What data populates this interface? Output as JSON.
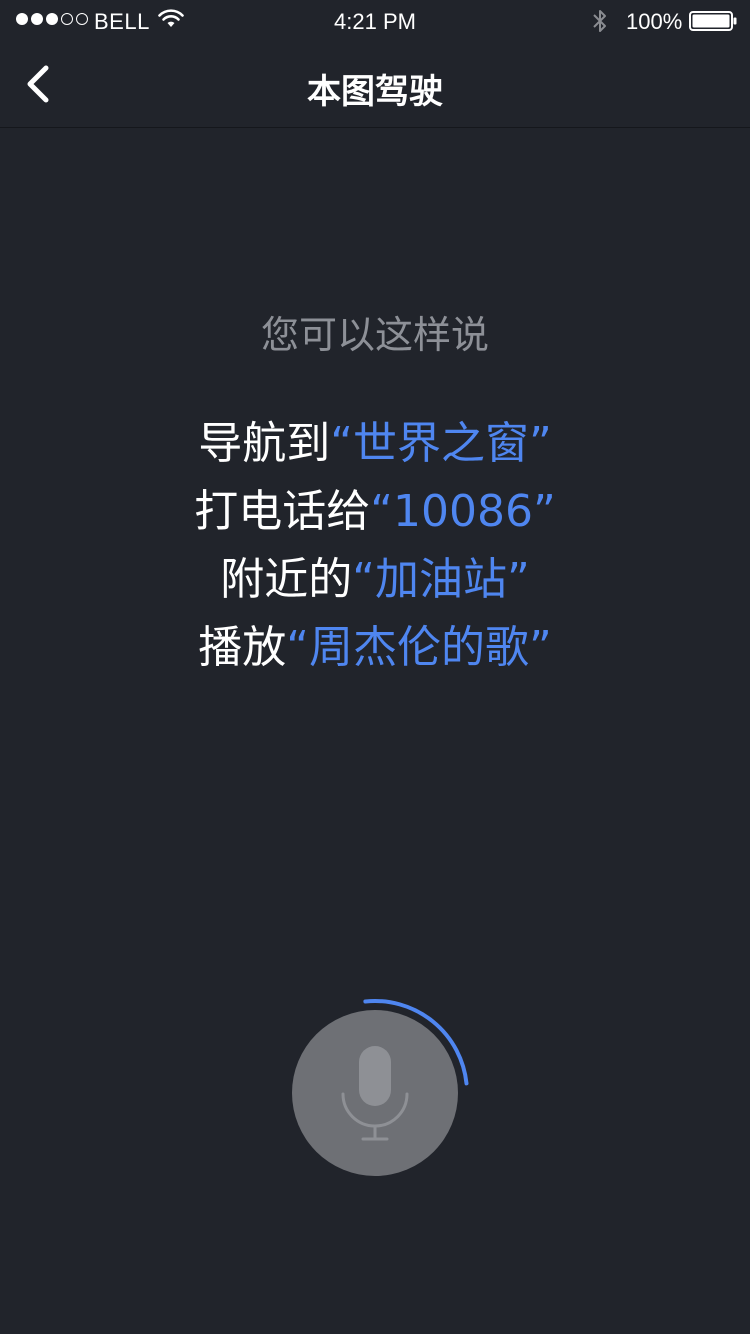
{
  "status_bar": {
    "carrier": "BELL",
    "time": "4:21 PM",
    "battery": "100%",
    "signal_bars_filled": 3,
    "signal_bars_total": 5,
    "icons": [
      "wifi-icon",
      "bluetooth-icon",
      "battery-icon"
    ]
  },
  "nav": {
    "title": "本图驾驶",
    "back_icon": "chevron-left-icon"
  },
  "hint": {
    "title": "您可以这样说",
    "examples": [
      {
        "prefix": "导航到",
        "quote": "“世界之窗”"
      },
      {
        "prefix": "打电话给",
        "quote": "“10086”"
      },
      {
        "prefix": "附近的",
        "quote": "“加油站”"
      },
      {
        "prefix": "播放",
        "quote": "“周杰伦的歌”"
      }
    ]
  },
  "mic": {
    "icon": "microphone-icon",
    "listening_progress": 0.25
  },
  "colors": {
    "background": "#21242b",
    "accent": "#4f86f0",
    "hint_text": "#8d9097",
    "mic_button": "#6e7075"
  }
}
